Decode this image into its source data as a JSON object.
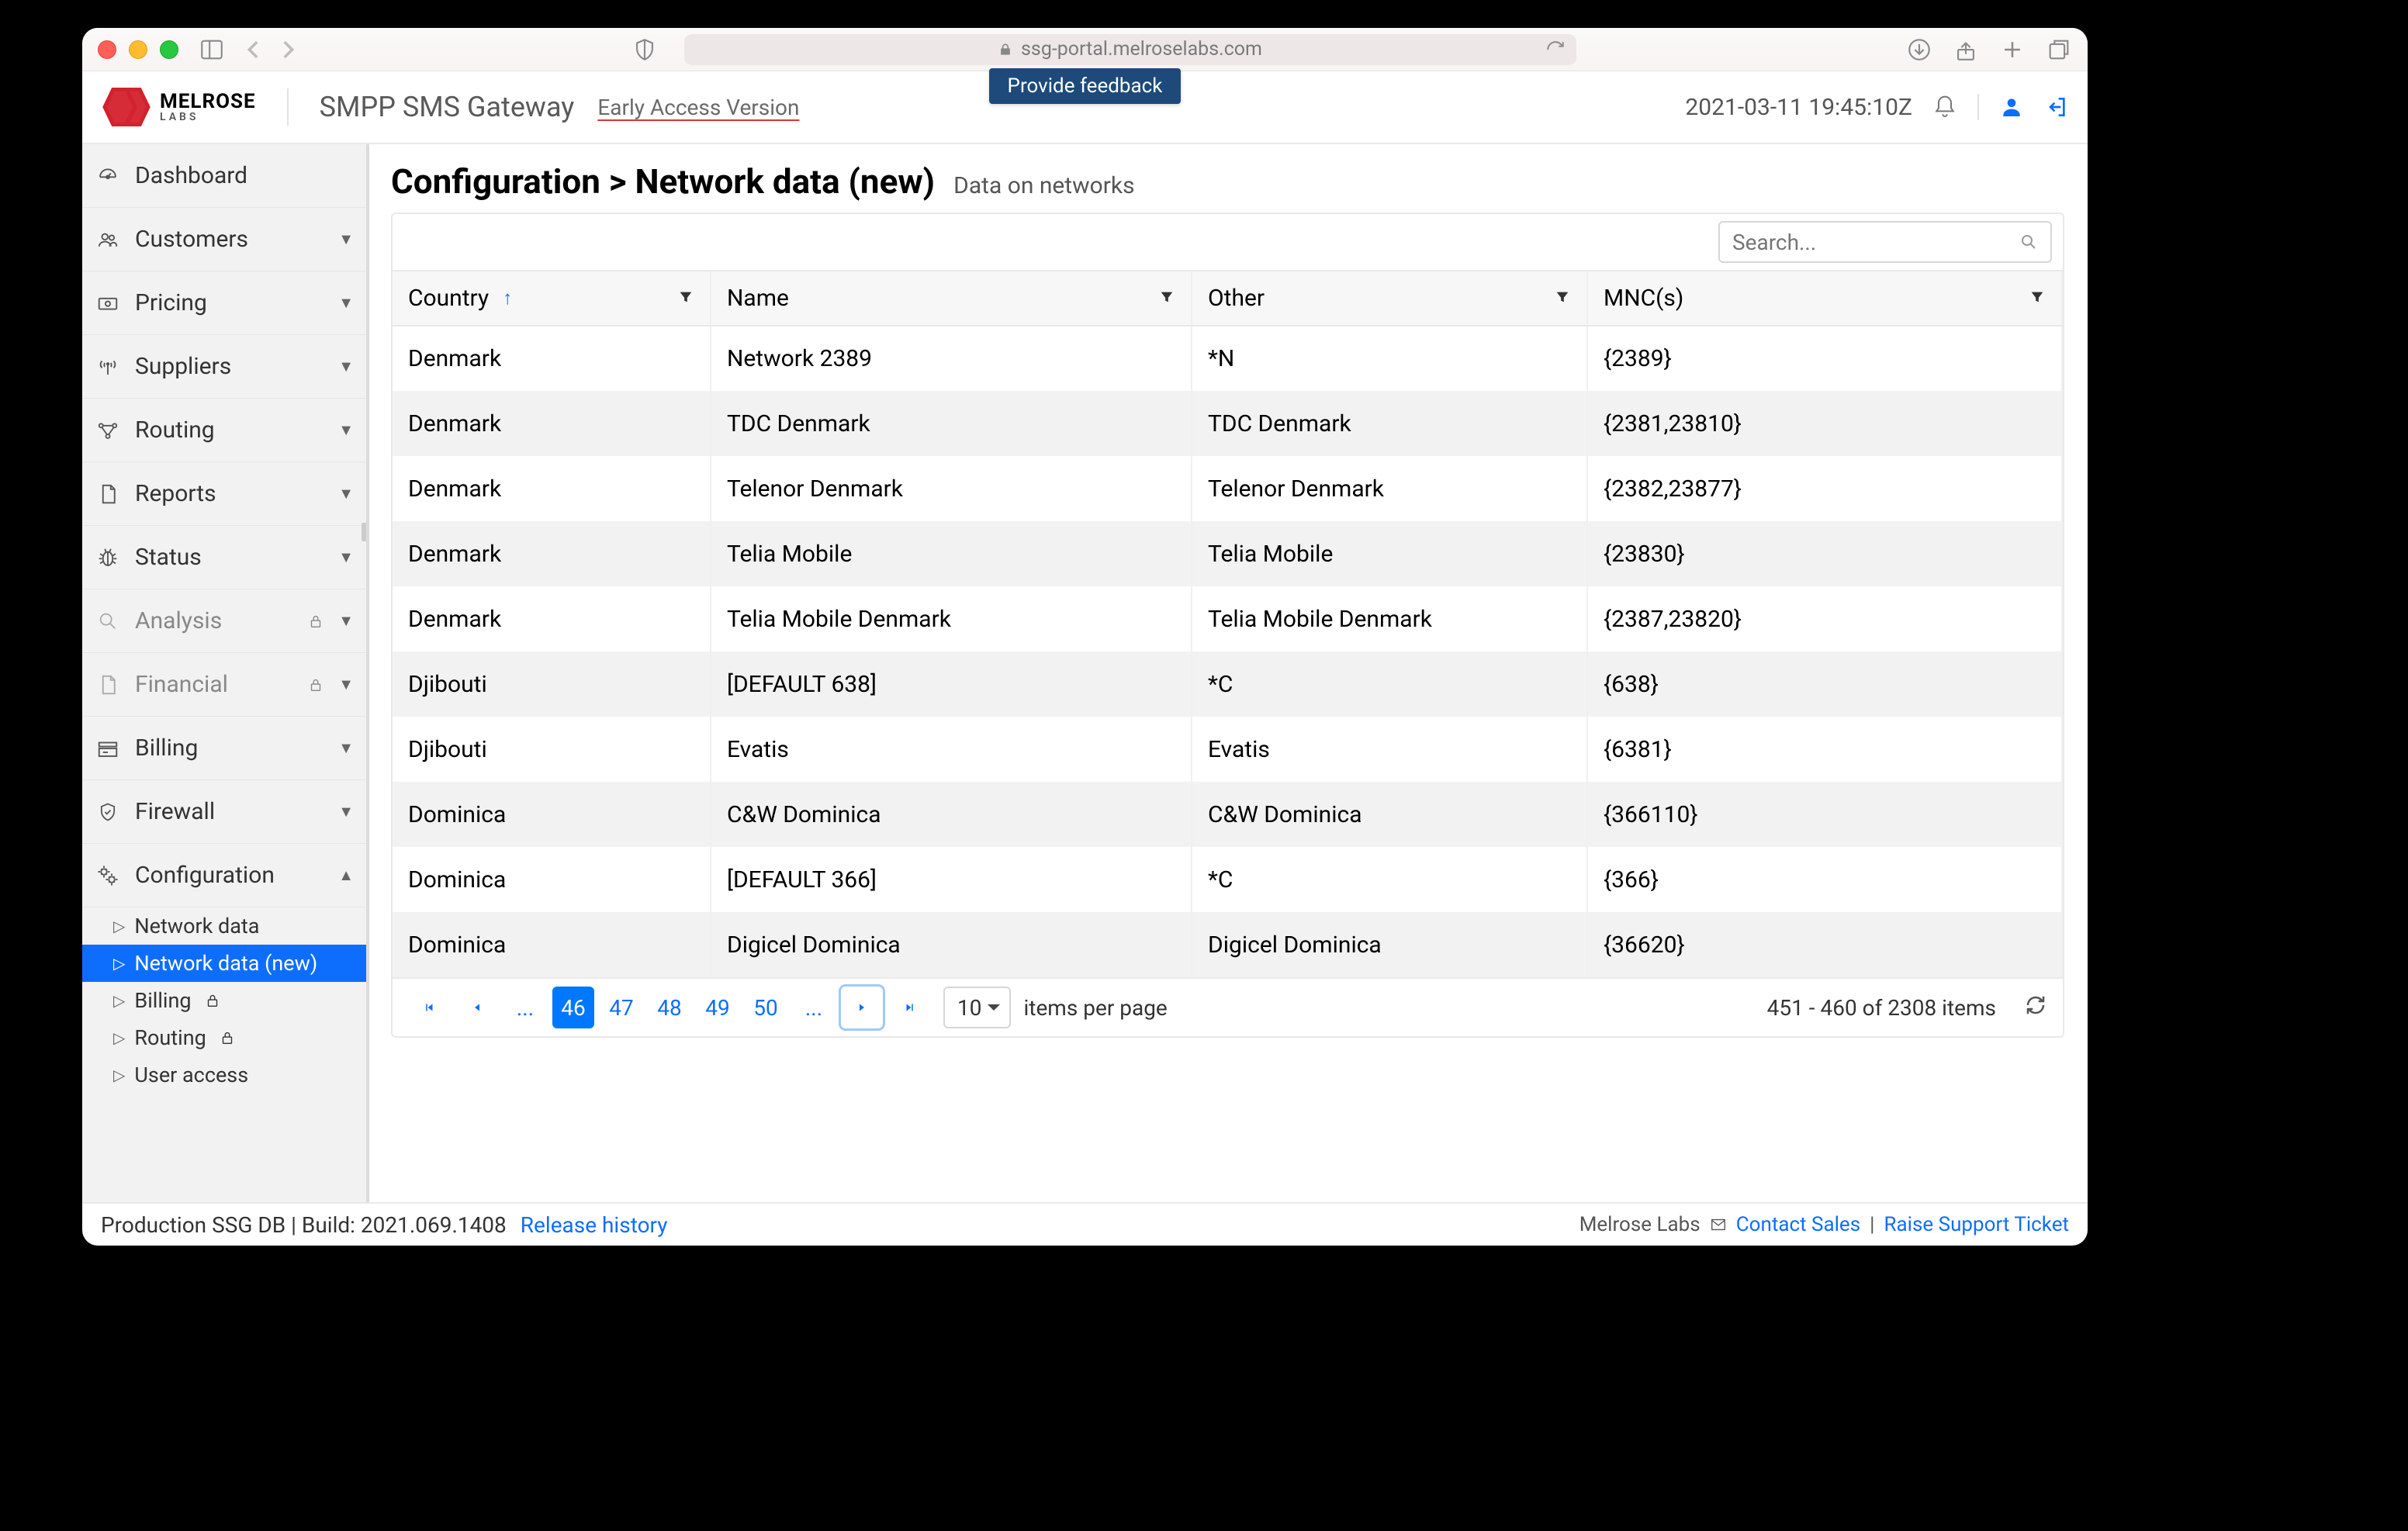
{
  "browser": {
    "url": "ssg-portal.melroselabs.com"
  },
  "header": {
    "brand_l1": "MELROSE",
    "brand_l2": "LABS",
    "app_name": "SMPP SMS Gateway",
    "version_label": "Early Access Version",
    "feedback_label": "Provide feedback",
    "timestamp": "2021-03-11 19:45:10Z"
  },
  "sidebar": {
    "items": [
      {
        "label": "Dashboard",
        "icon": "dashboard",
        "expandable": false
      },
      {
        "label": "Customers",
        "icon": "users",
        "expandable": true
      },
      {
        "label": "Pricing",
        "icon": "money",
        "expandable": true
      },
      {
        "label": "Suppliers",
        "icon": "antenna",
        "expandable": true
      },
      {
        "label": "Routing",
        "icon": "routing",
        "expandable": true
      },
      {
        "label": "Reports",
        "icon": "doc",
        "expandable": true
      },
      {
        "label": "Status",
        "icon": "bug",
        "expandable": true
      },
      {
        "label": "Analysis",
        "icon": "search",
        "expandable": true,
        "locked": true,
        "muted": true
      },
      {
        "label": "Financial",
        "icon": "doc",
        "expandable": true,
        "locked": true,
        "muted": true
      },
      {
        "label": "Billing",
        "icon": "billing",
        "expandable": true
      },
      {
        "label": "Firewall",
        "icon": "shield",
        "expandable": true
      },
      {
        "label": "Configuration",
        "icon": "gear",
        "expandable": true,
        "expanded": true
      }
    ],
    "config_children": [
      {
        "label": "Network data"
      },
      {
        "label": "Network data (new)",
        "active": true
      },
      {
        "label": "Billing",
        "locked": true
      },
      {
        "label": "Routing",
        "locked": true
      },
      {
        "label": "User access"
      }
    ]
  },
  "main": {
    "title": "Configuration > Network data (new)",
    "subtitle": "Data on networks",
    "search_placeholder": "Search...",
    "columns": [
      "Country",
      "Name",
      "Other",
      "MNC(s)"
    ],
    "sorted_column": "Country",
    "rows": [
      {
        "country": "Denmark",
        "name": "Network 2389",
        "other": "*N",
        "mnc": "{2389}"
      },
      {
        "country": "Denmark",
        "name": "TDC Denmark",
        "other": "TDC Denmark",
        "mnc": "{2381,23810}"
      },
      {
        "country": "Denmark",
        "name": "Telenor Denmark",
        "other": "Telenor Denmark",
        "mnc": "{2382,23877}"
      },
      {
        "country": "Denmark",
        "name": "Telia Mobile",
        "other": "Telia Mobile",
        "mnc": "{23830}"
      },
      {
        "country": "Denmark",
        "name": "Telia Mobile Denmark",
        "other": "Telia Mobile Denmark",
        "mnc": "{2387,23820}"
      },
      {
        "country": "Djibouti",
        "name": "[DEFAULT 638]",
        "other": "*C",
        "mnc": "{638}"
      },
      {
        "country": "Djibouti",
        "name": "Evatis",
        "other": "Evatis",
        "mnc": "{6381}"
      },
      {
        "country": "Dominica",
        "name": "C&W Dominica",
        "other": "C&W Dominica",
        "mnc": "{366110}"
      },
      {
        "country": "Dominica",
        "name": "[DEFAULT 366]",
        "other": "*C",
        "mnc": "{366}"
      },
      {
        "country": "Dominica",
        "name": "Digicel Dominica",
        "other": "Digicel Dominica",
        "mnc": "{36620}"
      }
    ],
    "pager": {
      "pages": [
        "46",
        "47",
        "48",
        "49",
        "50"
      ],
      "active": "46",
      "page_size": "10",
      "per_page_label": "items per page",
      "range": "451 - 460 of 2308 items"
    }
  },
  "footer": {
    "left1": "Production SSG DB  |  Build: 2021.069.1408",
    "release": "Release history",
    "company": "Melrose Labs",
    "contact": "Contact Sales",
    "support": "Raise Support Ticket"
  }
}
